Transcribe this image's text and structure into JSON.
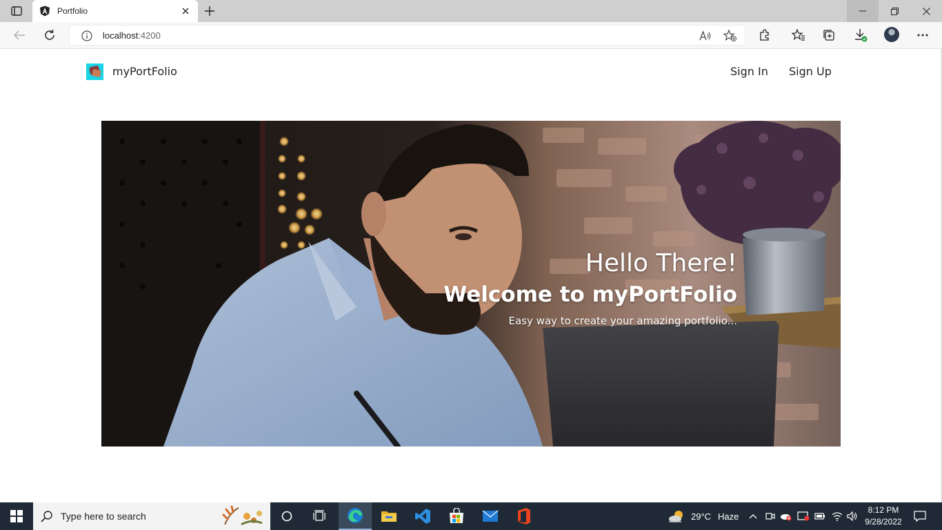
{
  "browser": {
    "tab_title": "Portfolio",
    "url_host": "localhost",
    "url_port": ":4200"
  },
  "navbar": {
    "brand": "myPortFolio",
    "sign_in": "Sign In",
    "sign_up": "Sign Up"
  },
  "hero": {
    "title": "Hello There!",
    "subtitle": "Welcome to myPortFolio",
    "tagline": "Easy way to create your amazing portfolio..."
  },
  "taskbar": {
    "search_placeholder": "Type here to search",
    "weather_temp": "29°C",
    "weather_desc": "Haze",
    "time": "8:12 PM",
    "date": "9/28/2022"
  },
  "icons": {
    "tab_favicon": "angular-icon",
    "back": "back-arrow-icon",
    "refresh": "refresh-icon",
    "info": "info-icon",
    "read_aloud": "read-aloud-icon",
    "favorite": "favorite-add-icon",
    "extensions": "extensions-icon",
    "favorites": "favorites-icon",
    "collections": "collections-icon",
    "downloads": "download-icon",
    "more": "more-icon"
  },
  "colors": {
    "tabbar": "#cfcfcf",
    "taskbar": "#1f2a36",
    "logo_bg": "#19d5e6"
  }
}
